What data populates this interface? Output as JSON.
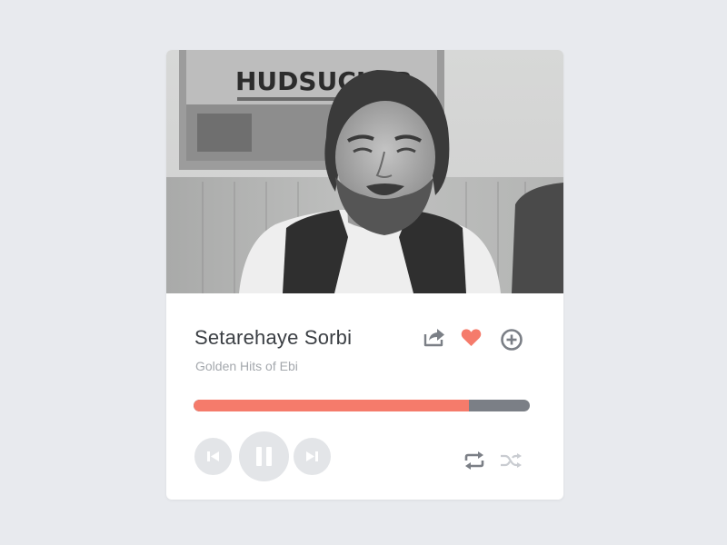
{
  "player": {
    "cover_sign_text": "HUDSUCKER",
    "track_title": "Setarehaye Sorbi",
    "album": "Golden Hits of Ebi",
    "progress_fraction": 0.82,
    "colors": {
      "accent": "#f57b6b",
      "track_bg": "#7b7f86",
      "control_bg": "#e3e5e8",
      "icon_gray": "#7b7f86",
      "icon_light": "#c9ccd1",
      "heart": "#f57b6b"
    },
    "icons": {
      "share": "share-icon",
      "favorite": "heart-icon",
      "add": "add-icon",
      "previous": "previous-icon",
      "pause": "pause-icon",
      "next": "next-icon",
      "repeat": "repeat-icon",
      "shuffle": "shuffle-icon"
    }
  }
}
